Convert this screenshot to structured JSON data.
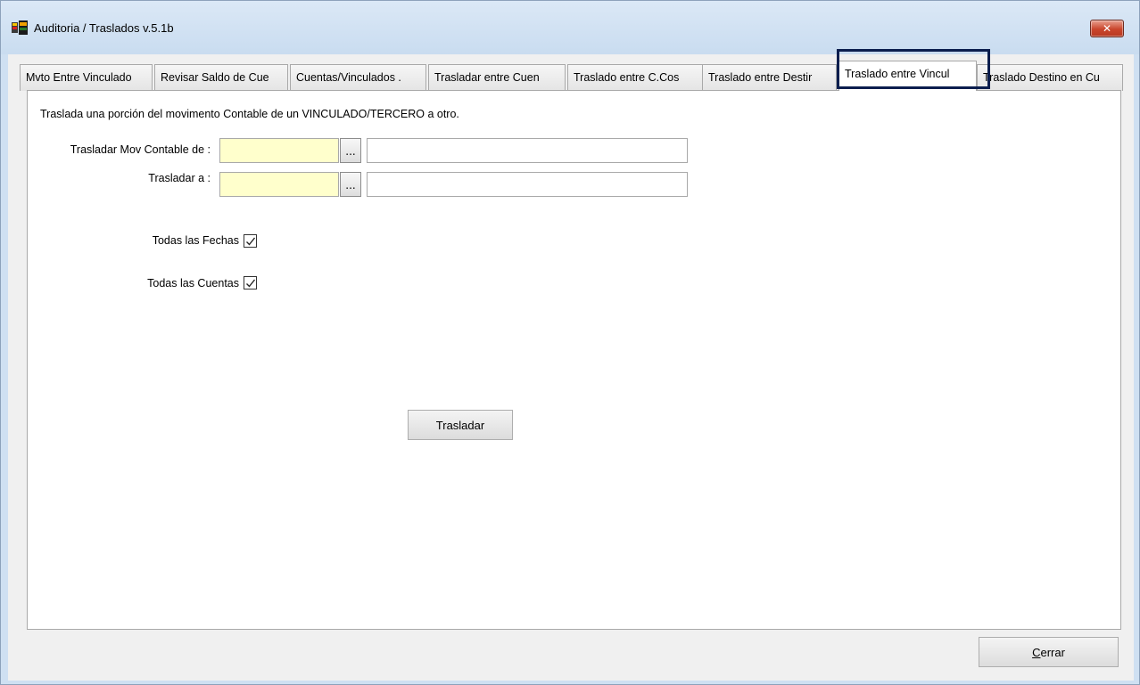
{
  "window": {
    "title": "Auditoria / Traslados  v.5.1b",
    "close_glyph": "✕"
  },
  "tabs": [
    {
      "label": "Mvto Entre Vinculado"
    },
    {
      "label": "Revisar Saldo de Cue"
    },
    {
      "label": "Cuentas/Vinculados ."
    },
    {
      "label": "Trasladar entre Cuen"
    },
    {
      "label": "Traslado entre C.Cos"
    },
    {
      "label": "Traslado entre Destir"
    },
    {
      "label": "Traslado entre Vincul",
      "active": true
    },
    {
      "label": "Traslado Destino en Cu"
    }
  ],
  "panel": {
    "description": "Traslada una porción del movimento Contable de un VINCULADO/TERCERO a otro.",
    "from_label": "Trasladar Mov Contable de :",
    "to_label": "Trasladar a :",
    "browse_label": "...",
    "from_code": "",
    "from_name": "",
    "to_code": "",
    "to_name": "",
    "all_dates_label": "Todas las Fechas",
    "all_dates_checked": true,
    "all_accounts_label": "Todas las Cuentas",
    "all_accounts_checked": true,
    "transfer_button": "Trasladar"
  },
  "footer": {
    "close_button_first": "C",
    "close_button_rest": "errar"
  },
  "colors": {
    "code_field_bg": "#ffffcc",
    "highlight_border": "#0b1e4e"
  }
}
